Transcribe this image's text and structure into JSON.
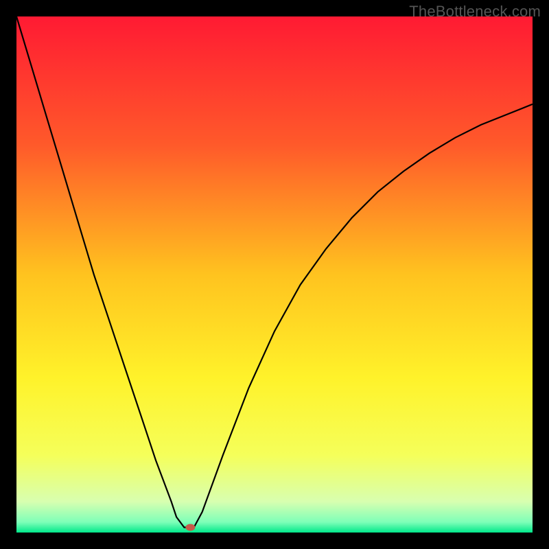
{
  "watermark": "TheBottleneck.com",
  "chart_data": {
    "type": "line",
    "title": "",
    "xlabel": "",
    "ylabel": "",
    "xlim": [
      0,
      100
    ],
    "ylim": [
      0,
      100
    ],
    "grid": false,
    "legend": false,
    "background_gradient": {
      "stops": [
        {
          "pos": 0.0,
          "color": "#ff1a33"
        },
        {
          "pos": 0.25,
          "color": "#ff5a2a"
        },
        {
          "pos": 0.5,
          "color": "#ffc31f"
        },
        {
          "pos": 0.7,
          "color": "#fff22a"
        },
        {
          "pos": 0.85,
          "color": "#f5ff5a"
        },
        {
          "pos": 0.94,
          "color": "#d8ffb0"
        },
        {
          "pos": 0.98,
          "color": "#7dffb8"
        },
        {
          "pos": 1.0,
          "color": "#00e88a"
        }
      ]
    },
    "series": [
      {
        "name": "curve",
        "color": "#000000",
        "x": [
          0,
          3,
          6,
          9,
          12,
          15,
          18,
          21,
          24,
          27,
          30,
          31,
          32.5,
          34,
          34.5,
          36,
          40,
          45,
          50,
          55,
          60,
          65,
          70,
          75,
          80,
          85,
          90,
          95,
          100
        ],
        "y": [
          100,
          90,
          80,
          70,
          60,
          50,
          41,
          32,
          23,
          14,
          6,
          3,
          1,
          1,
          1.2,
          4,
          15,
          28,
          39,
          48,
          55,
          61,
          66,
          70,
          73.5,
          76.5,
          79,
          81,
          83
        ]
      }
    ],
    "marker": {
      "name": "min-point",
      "x": 33.7,
      "y": 1.0,
      "color": "#c75a4a",
      "rx": 7,
      "ry": 5
    }
  }
}
